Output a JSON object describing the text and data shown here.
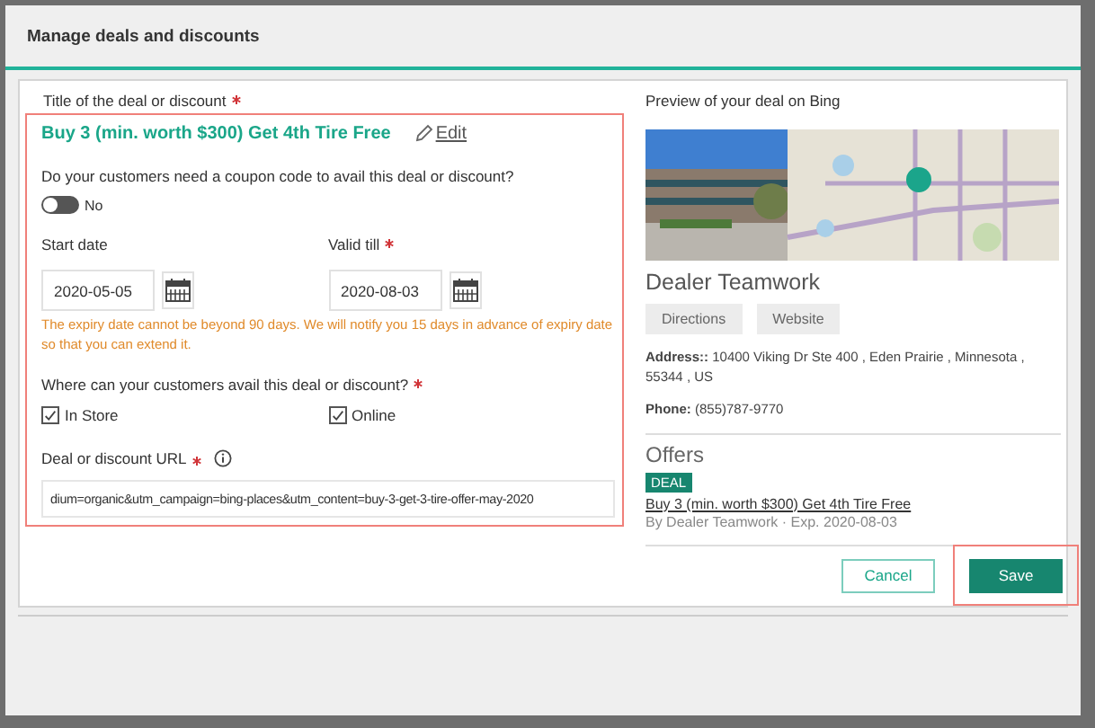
{
  "dialog": {
    "title": "Manage deals and discounts"
  },
  "form": {
    "title_label": "Title of the deal or discount",
    "title_required": true,
    "deal_title": "Buy 3 (min. worth $300) Get 4th Tire Free",
    "edit_link": "Edit",
    "coupon_question": "Do your customers need a coupon code to avail this deal or discount?",
    "coupon_toggle": {
      "on": false,
      "label": "No"
    },
    "start_date": {
      "label": "Start date",
      "required": false,
      "value": "2020-05-05"
    },
    "valid_till": {
      "label": "Valid till",
      "required": true,
      "value": "2020-08-03"
    },
    "date_note": "The expiry date cannot be beyond 90 days. We will notify you 15 days in advance of expiry date so that you can extend it.",
    "where_question": "Where can your customers avail this deal or discount?",
    "where_required": true,
    "where_options": [
      {
        "label": "In Store",
        "checked": true
      },
      {
        "label": "Online",
        "checked": true
      }
    ],
    "url_label": "Deal or discount URL",
    "url_required": true,
    "url_value": "dium=organic&utm_campaign=bing-places&utm_content=buy-3-get-3-tire-offer-may-2020"
  },
  "preview": {
    "heading": "Preview of your deal on Bing",
    "business_name": "Dealer Teamwork",
    "buttons": [
      "Directions",
      "Website"
    ],
    "address_label": "Address::",
    "address": "10400 Viking Dr Ste 400 , Eden Prairie , Minnesota , 55344 , US",
    "phone_label": "Phone:",
    "phone": "(855)787-9770",
    "offers_heading": "Offers",
    "offer_tag": "DEAL",
    "offer_title": "Buy 3 (min. worth $300) Get 4th Tire Free",
    "offer_meta": "By Dealer Teamwork · Exp. 2020-08-03"
  },
  "footer_buttons": [
    {
      "label": "Cancel",
      "kind": "secondary"
    },
    {
      "label": "Save",
      "kind": "primary"
    }
  ]
}
